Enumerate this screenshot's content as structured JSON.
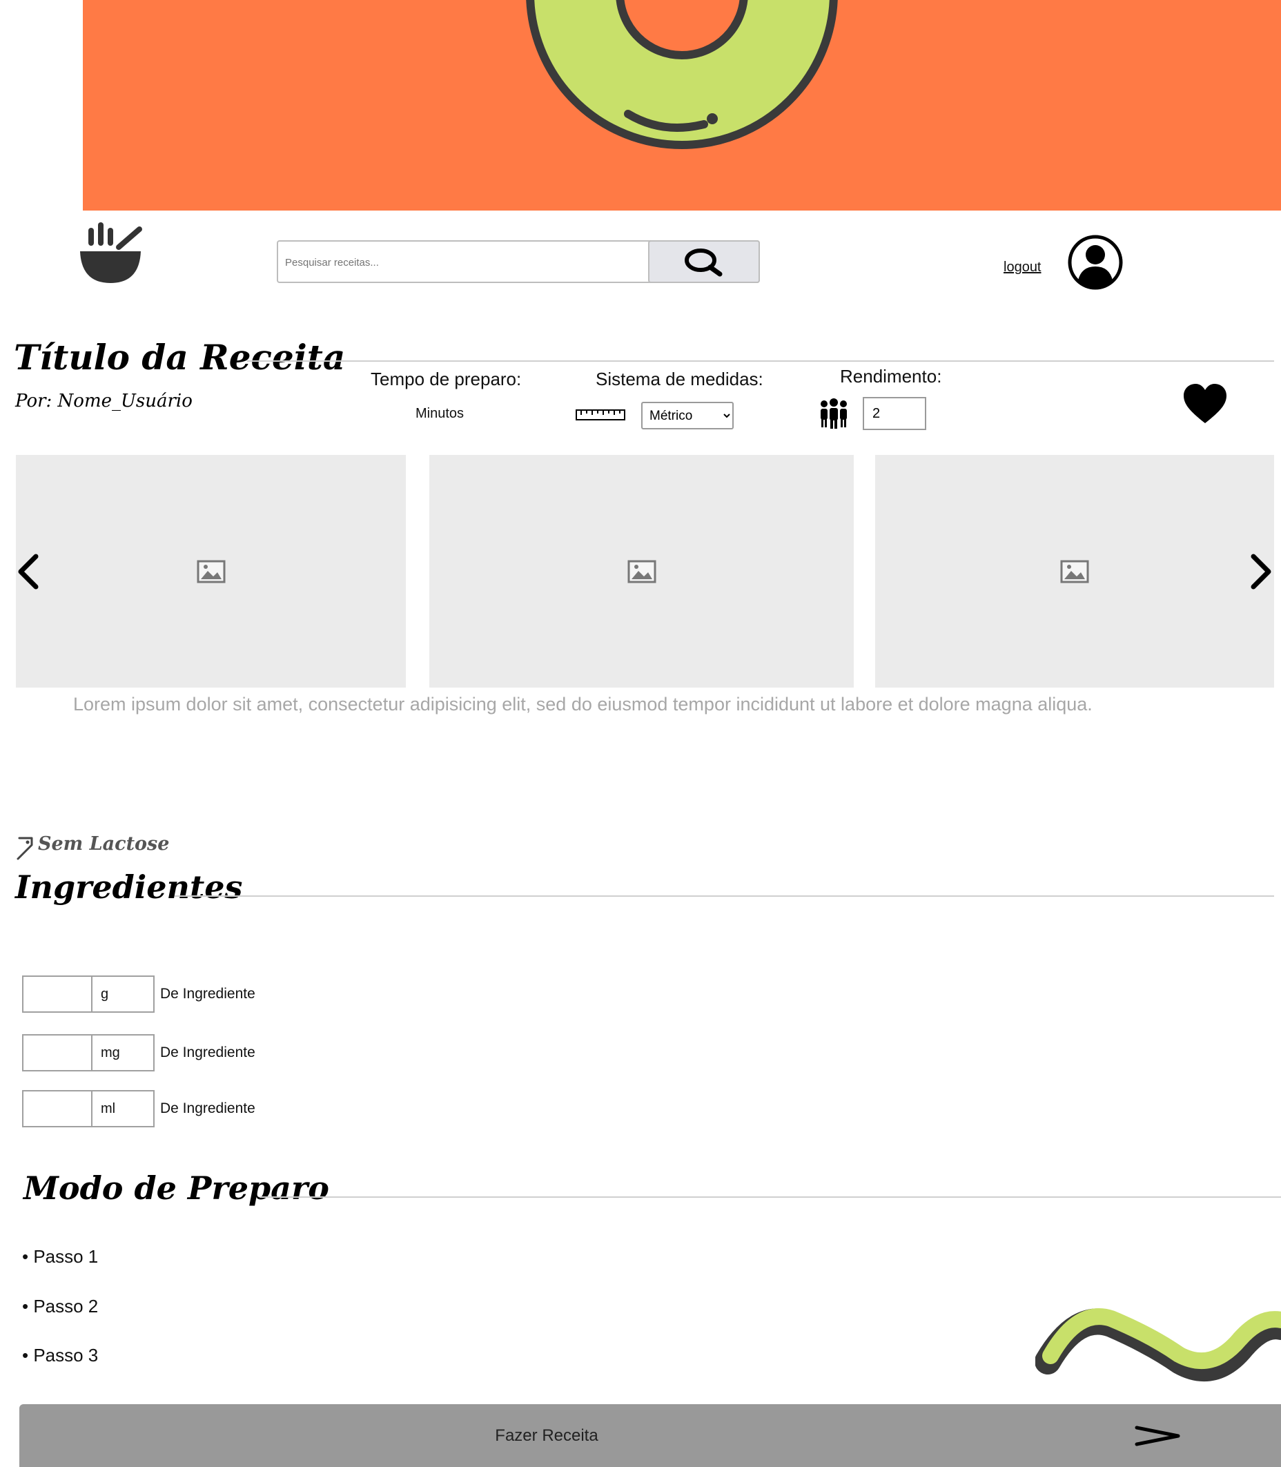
{
  "header": {
    "search_placeholder": "Pesquisar receitas...",
    "logout_label": "logout"
  },
  "recipe": {
    "title": "Título da Receita",
    "author": "Por: Nome_Usuário",
    "prep_time_label": "Tempo de preparo:",
    "prep_time_value": "Minutos",
    "measure_label": "Sistema de medidas:",
    "measure_selected": "Métrico",
    "yield_label": "Rendimento:",
    "yield_value": "2",
    "description": "Lorem ipsum dolor sit amet, consectetur adipisicing elit, sed do eiusmod tempor incididunt ut labore et dolore magna aliqua.",
    "tag": "Sem Lactose"
  },
  "ingredients": {
    "title": "Ingredientes",
    "items": [
      {
        "qty": "",
        "unit": "g",
        "name": "De Ingrediente"
      },
      {
        "qty": "",
        "unit": "mg",
        "name": "De Ingrediente"
      },
      {
        "qty": "",
        "unit": "ml",
        "name": "De Ingrediente"
      }
    ]
  },
  "method": {
    "title": "Modo de Preparo",
    "steps": [
      "• Passo 1",
      "• Passo 2",
      "• Passo 3"
    ]
  },
  "actions": {
    "make_recipe_label": "Fazer Receita"
  },
  "colors": {
    "banner": "#ff7a45",
    "accent_green": "#c8e06a",
    "dark": "#3a3a3a",
    "button_gray": "#999999"
  }
}
